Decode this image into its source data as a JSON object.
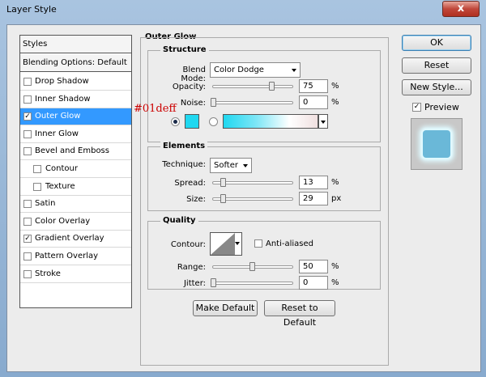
{
  "window": {
    "title": "Layer Style",
    "close_label": "x"
  },
  "styles": {
    "header": "Styles",
    "blending": "Blending Options: Default",
    "items": [
      {
        "label": "Drop Shadow",
        "checked": false,
        "selected": false,
        "indent": false
      },
      {
        "label": "Inner Shadow",
        "checked": false,
        "selected": false,
        "indent": false
      },
      {
        "label": "Outer Glow",
        "checked": true,
        "selected": true,
        "indent": false
      },
      {
        "label": "Inner Glow",
        "checked": false,
        "selected": false,
        "indent": false
      },
      {
        "label": "Bevel and Emboss",
        "checked": false,
        "selected": false,
        "indent": false
      },
      {
        "label": "Contour",
        "checked": false,
        "selected": false,
        "indent": true
      },
      {
        "label": "Texture",
        "checked": false,
        "selected": false,
        "indent": true
      },
      {
        "label": "Satin",
        "checked": false,
        "selected": false,
        "indent": false
      },
      {
        "label": "Color Overlay",
        "checked": false,
        "selected": false,
        "indent": false
      },
      {
        "label": "Gradient Overlay",
        "checked": true,
        "selected": false,
        "indent": false
      },
      {
        "label": "Pattern Overlay",
        "checked": false,
        "selected": false,
        "indent": false
      },
      {
        "label": "Stroke",
        "checked": false,
        "selected": false,
        "indent": false
      }
    ]
  },
  "outer_glow": {
    "title": "Outer Glow",
    "structure": {
      "title": "Structure",
      "blend_mode_label": "Blend Mode:",
      "blend_mode_value": "Color Dodge",
      "opacity_label": "Opacity:",
      "opacity_value": "75",
      "opacity_unit": "%",
      "opacity_level": 0.75,
      "noise_label": "Noise:",
      "noise_value": "0",
      "noise_unit": "%",
      "noise_level": 0,
      "color_annotation": "#01deff",
      "color_swatch": "#20d8f0"
    },
    "elements": {
      "title": "Elements",
      "technique_label": "Technique:",
      "technique_value": "Softer",
      "spread_label": "Spread:",
      "spread_value": "13",
      "spread_unit": "%",
      "spread_level": 0.13,
      "size_label": "Size:",
      "size_value": "29",
      "size_unit": "px",
      "size_level": 0.12
    },
    "quality": {
      "title": "Quality",
      "contour_label": "Contour:",
      "anti_aliased_label": "Anti-aliased",
      "range_label": "Range:",
      "range_value": "50",
      "range_unit": "%",
      "range_level": 0.5,
      "jitter_label": "Jitter:",
      "jitter_value": "0",
      "jitter_unit": "%",
      "jitter_level": 0
    },
    "make_default": "Make Default",
    "reset_default": "Reset to Default"
  },
  "side": {
    "ok": "OK",
    "reset": "Reset",
    "new_style": "New Style...",
    "preview_label": "Preview",
    "preview_checked": true
  },
  "colors": {
    "accent": "#3399ff",
    "glow": "#01deff",
    "annotation": "#cc0000"
  }
}
